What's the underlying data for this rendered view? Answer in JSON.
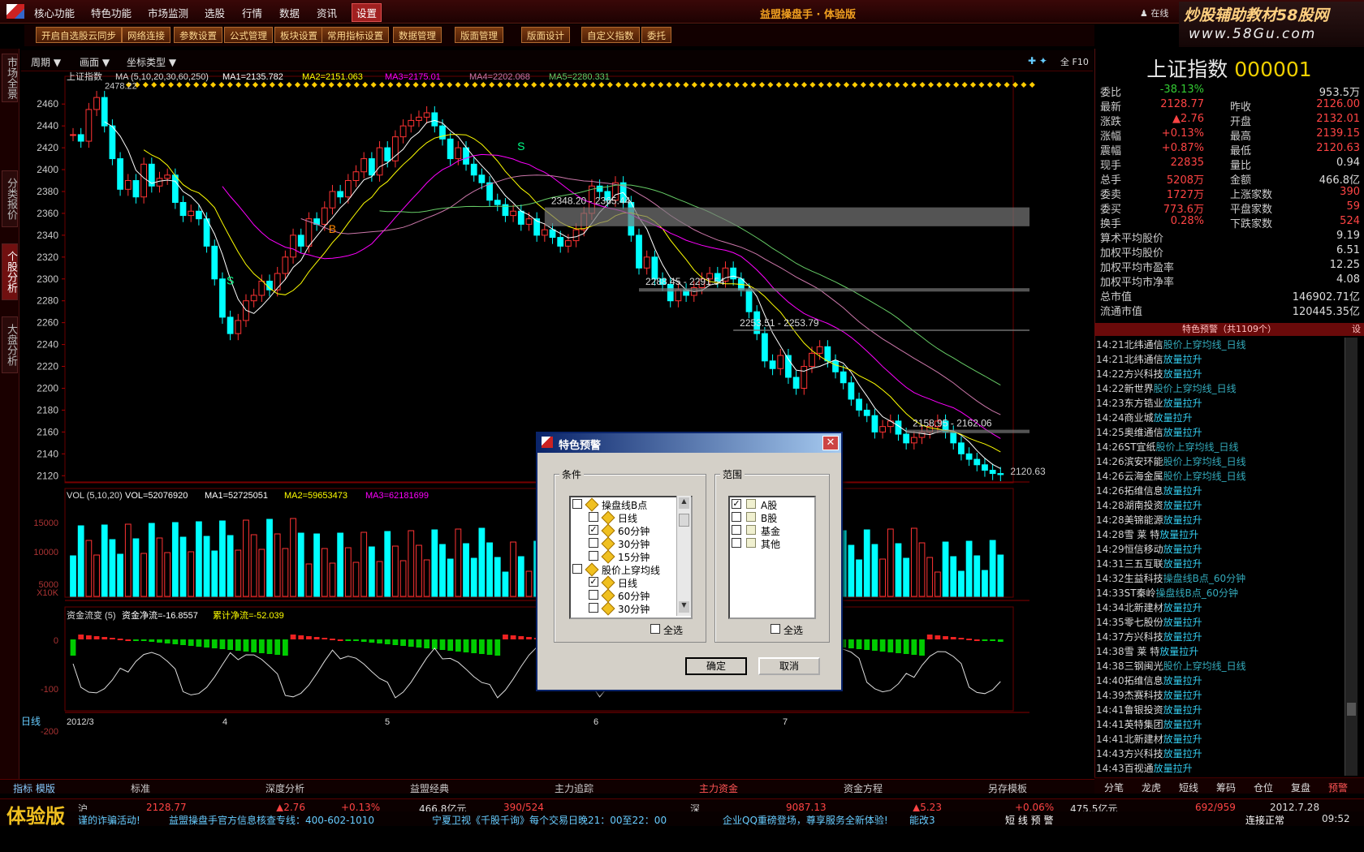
{
  "menubar": {
    "items": [
      "核心功能",
      "特色功能",
      "市场监测",
      "选股",
      "行情",
      "数据",
      "资讯",
      "设置"
    ],
    "title": "益盟操盘手 · 体验版",
    "online": "在线"
  },
  "watermark": {
    "line1": "炒股辅助教材58股网",
    "line2": "www.58Gu.com"
  },
  "toolbar": [
    "开启自选股云同步",
    "网络连接",
    "参数设置",
    "公式管理",
    "板块设置",
    "常用指标设置",
    "数据管理",
    "版面管理",
    "版面设计",
    "自定义指数",
    "委托"
  ],
  "leftbar": [
    "市场全景",
    "分类报价",
    "个股分析",
    "大盘分析"
  ],
  "chart_head": {
    "period": "周期",
    "screen": "画面",
    "coord": "坐标类型",
    "tools": "全 F10"
  },
  "chart_data": {
    "type": "candlestick",
    "title": "上证指数",
    "ma_legend": {
      "label": "MA (5,10,20,30,60,250)",
      "ma1": "MA1=2135.782",
      "ma2": "MA2=2151.063",
      "ma3": "MA3=2175.01",
      "ma4": "MA4=2202.068",
      "ma5": "MA5=2280.331"
    },
    "ylim": [
      2115,
      2475
    ],
    "yticks": [
      2460,
      2440,
      2420,
      2400,
      2380,
      2360,
      2340,
      2320,
      2300,
      2280,
      2260,
      2240,
      2220,
      2200,
      2180,
      2160,
      2140,
      2120
    ],
    "high_label": "2478.22",
    "low_label": "2120.63",
    "gap_labels": [
      "2348.20 - 2365.44",
      "2288.45 - 2291.54",
      "2253.51 - 2253.79",
      "2158.95 - 2162.06"
    ],
    "signals": [
      "S",
      "B",
      "S"
    ],
    "closes": [
      2432,
      2426,
      2455,
      2466,
      2440,
      2410,
      2382,
      2390,
      2375,
      2405,
      2385,
      2392,
      2395,
      2370,
      2358,
      2362,
      2355,
      2330,
      2300,
      2265,
      2250,
      2262,
      2280,
      2285,
      2298,
      2290,
      2305,
      2320,
      2340,
      2330,
      2355,
      2350,
      2365,
      2380,
      2375,
      2390,
      2398,
      2410,
      2395,
      2420,
      2408,
      2430,
      2440,
      2445,
      2448,
      2452,
      2440,
      2428,
      2410,
      2420,
      2405,
      2395,
      2388,
      2372,
      2368,
      2358,
      2362,
      2350,
      2355,
      2340,
      2345,
      2338,
      2330,
      2335,
      2345,
      2360,
      2385,
      2380,
      2372,
      2388,
      2370,
      2340,
      2310,
      2320,
      2300,
      2295,
      2280,
      2290,
      2285,
      2292,
      2300,
      2305,
      2298,
      2310,
      2300,
      2290,
      2270,
      2250,
      2225,
      2218,
      2230,
      2210,
      2200,
      2220,
      2232,
      2238,
      2225,
      2215,
      2205,
      2190,
      2180,
      2175,
      2160,
      2165,
      2170,
      2158,
      2150,
      2155,
      2160,
      2165,
      2170,
      2160,
      2150,
      2140,
      2135,
      2130,
      2125,
      2122,
      2121
    ],
    "vol_legend": {
      "label": "VOL (5,10,20)",
      "vol": "VOL=52076920",
      "ma1": "MA1=52725051",
      "ma2": "MA2=59653473",
      "ma3": "MA3=62181699"
    },
    "vol_ticks": [
      "15000",
      "10000",
      "5000",
      "X10K"
    ],
    "flow_legend": {
      "label": "资金流变 (5)",
      "net": "资金净流=-16.8557",
      "cum": "累计净流=-52.039"
    },
    "flow_ticks": [
      "0",
      "-100",
      "-200"
    ],
    "dates": [
      "2012/3",
      "4",
      "5",
      "6",
      "7"
    ],
    "period": "日线"
  },
  "right_panel": {
    "name": "上证指数",
    "code": "000001",
    "rows": [
      [
        "委比",
        "-38.13%",
        "",
        "953.5万"
      ],
      [
        "最新",
        "2128.77",
        "昨收",
        "2126.00"
      ],
      [
        "涨跌",
        "▲2.76",
        "开盘",
        "2132.01"
      ],
      [
        "涨幅",
        "+0.13%",
        "最高",
        "2139.15"
      ],
      [
        "震幅",
        "+0.87%",
        "最低",
        "2120.63"
      ],
      [
        "现手",
        "22835",
        "量比",
        "0.94"
      ],
      [
        "总手",
        "5208万",
        "金额",
        "466.8亿"
      ],
      [
        "委卖",
        "1727万",
        "上涨家数",
        "390"
      ],
      [
        "委买",
        "773.6万",
        "平盘家数",
        "59"
      ],
      [
        "换手",
        "0.28%",
        "下跌家数",
        "524"
      ]
    ],
    "stats": [
      [
        "算术平均股价",
        "9.19"
      ],
      [
        "加权平均股价",
        "6.51"
      ],
      [
        "加权平均市盈率",
        "12.25"
      ],
      [
        "加权平均市净率",
        "4.08"
      ],
      [
        "总市值",
        "146902.71亿"
      ],
      [
        "流通市值",
        "120445.35亿"
      ]
    ],
    "alert_head": "特色预警（共1109个）",
    "alert_set": "设",
    "alerts": [
      [
        "14:21",
        "北纬通信",
        "股价上穿均线_日线"
      ],
      [
        "14:21",
        "北纬通信",
        "放量拉升"
      ],
      [
        "14:22",
        "方兴科技",
        "放量拉升"
      ],
      [
        "14:22",
        "新世界",
        "股价上穿均线_日线"
      ],
      [
        "14:23",
        "东方锆业",
        "放量拉升"
      ],
      [
        "14:24",
        "商业城",
        "放量拉升"
      ],
      [
        "14:25",
        "奥维通信",
        "放量拉升"
      ],
      [
        "14:26",
        "ST宜纸",
        "股价上穿均线_日线"
      ],
      [
        "14:26",
        "滨安环能",
        "股价上穿均线_日线"
      ],
      [
        "14:26",
        "云海金属",
        "股价上穿均线_日线"
      ],
      [
        "14:26",
        "拓维信息",
        "放量拉升"
      ],
      [
        "14:28",
        "湖南投资",
        "放量拉升"
      ],
      [
        "14:28",
        "美锦能源",
        "放量拉升"
      ],
      [
        "14:28",
        "雪 莱 特",
        "放量拉升"
      ],
      [
        "14:29",
        "恒信移动",
        "放量拉升"
      ],
      [
        "14:31",
        "三五互联",
        "放量拉升"
      ],
      [
        "14:32",
        "生益科技",
        "操盘线B点_60分钟"
      ],
      [
        "14:33",
        "ST秦岭",
        "操盘线B点_60分钟"
      ],
      [
        "14:34",
        "北新建材",
        "放量拉升"
      ],
      [
        "14:35",
        "零七股份",
        "放量拉升"
      ],
      [
        "14:37",
        "方兴科技",
        "放量拉升"
      ],
      [
        "14:38",
        "雪 莱 特",
        "放量拉升"
      ],
      [
        "14:38",
        "三钢闽光",
        "股价上穿均线_日线"
      ],
      [
        "14:40",
        "拓维信息",
        "放量拉升"
      ],
      [
        "14:39",
        "杰赛科技",
        "放量拉升"
      ],
      [
        "14:41",
        "鲁银投资",
        "放量拉升"
      ],
      [
        "14:41",
        "英特集团",
        "放量拉升"
      ],
      [
        "14:41",
        "北新建材",
        "放量拉升"
      ],
      [
        "14:43",
        "方兴科技",
        "放量拉升"
      ],
      [
        "14:43",
        "百视通",
        "放量拉升"
      ]
    ],
    "tabs": [
      "分笔",
      "龙虎",
      "短线",
      "筹码",
      "仓位",
      "复盘",
      "预警"
    ]
  },
  "bottom_tabs": {
    "lead": "指标 模版",
    "items": [
      "标准",
      "深度分析",
      "益盟经典",
      "主力追踪",
      "主力资金",
      "资金方程",
      "另存模板"
    ]
  },
  "status": {
    "trial": "体验版",
    "sh": [
      "沪",
      "2128.77",
      "▲2.76",
      "+0.13%",
      "466.8亿元",
      "390/524"
    ],
    "sz": [
      "深",
      "9087.13",
      "▲5.23",
      "+0.06%",
      "475.5亿元",
      "692/959"
    ],
    "date": "2012.7.28",
    "time": "09:52",
    "ticker": [
      "谨的诈骗活动!",
      "益盟操盘手官方信息核查专线：400-602-1010",
      "宁夏卫视《千股千询》每个交易日晚21：00至22：00",
      "企业QQ重磅登场，尊享服务全新体验!",
      "能改3"
    ],
    "short_alert": "短 线 预 警",
    "conn": "连接正常"
  },
  "dialog": {
    "title": "特色预警",
    "cond_label": "条件",
    "range_label": "范围",
    "conds": [
      {
        "label": "操盘线B点",
        "checked": false,
        "level": 0
      },
      {
        "label": "日线",
        "checked": false,
        "level": 1
      },
      {
        "label": "60分钟",
        "checked": true,
        "level": 1
      },
      {
        "label": "30分钟",
        "checked": false,
        "level": 1
      },
      {
        "label": "15分钟",
        "checked": false,
        "level": 1
      },
      {
        "label": "股价上穿均线",
        "checked": false,
        "level": 0
      },
      {
        "label": "日线",
        "checked": true,
        "level": 1
      },
      {
        "label": "60分钟",
        "checked": false,
        "level": 1
      },
      {
        "label": "30分钟",
        "checked": false,
        "level": 1
      }
    ],
    "ranges": [
      {
        "label": "A股",
        "checked": true
      },
      {
        "label": "B股",
        "checked": false
      },
      {
        "label": "基金",
        "checked": false
      },
      {
        "label": "其他",
        "checked": false
      }
    ],
    "select_all": "全选",
    "ok": "确定",
    "cancel": "取消"
  }
}
